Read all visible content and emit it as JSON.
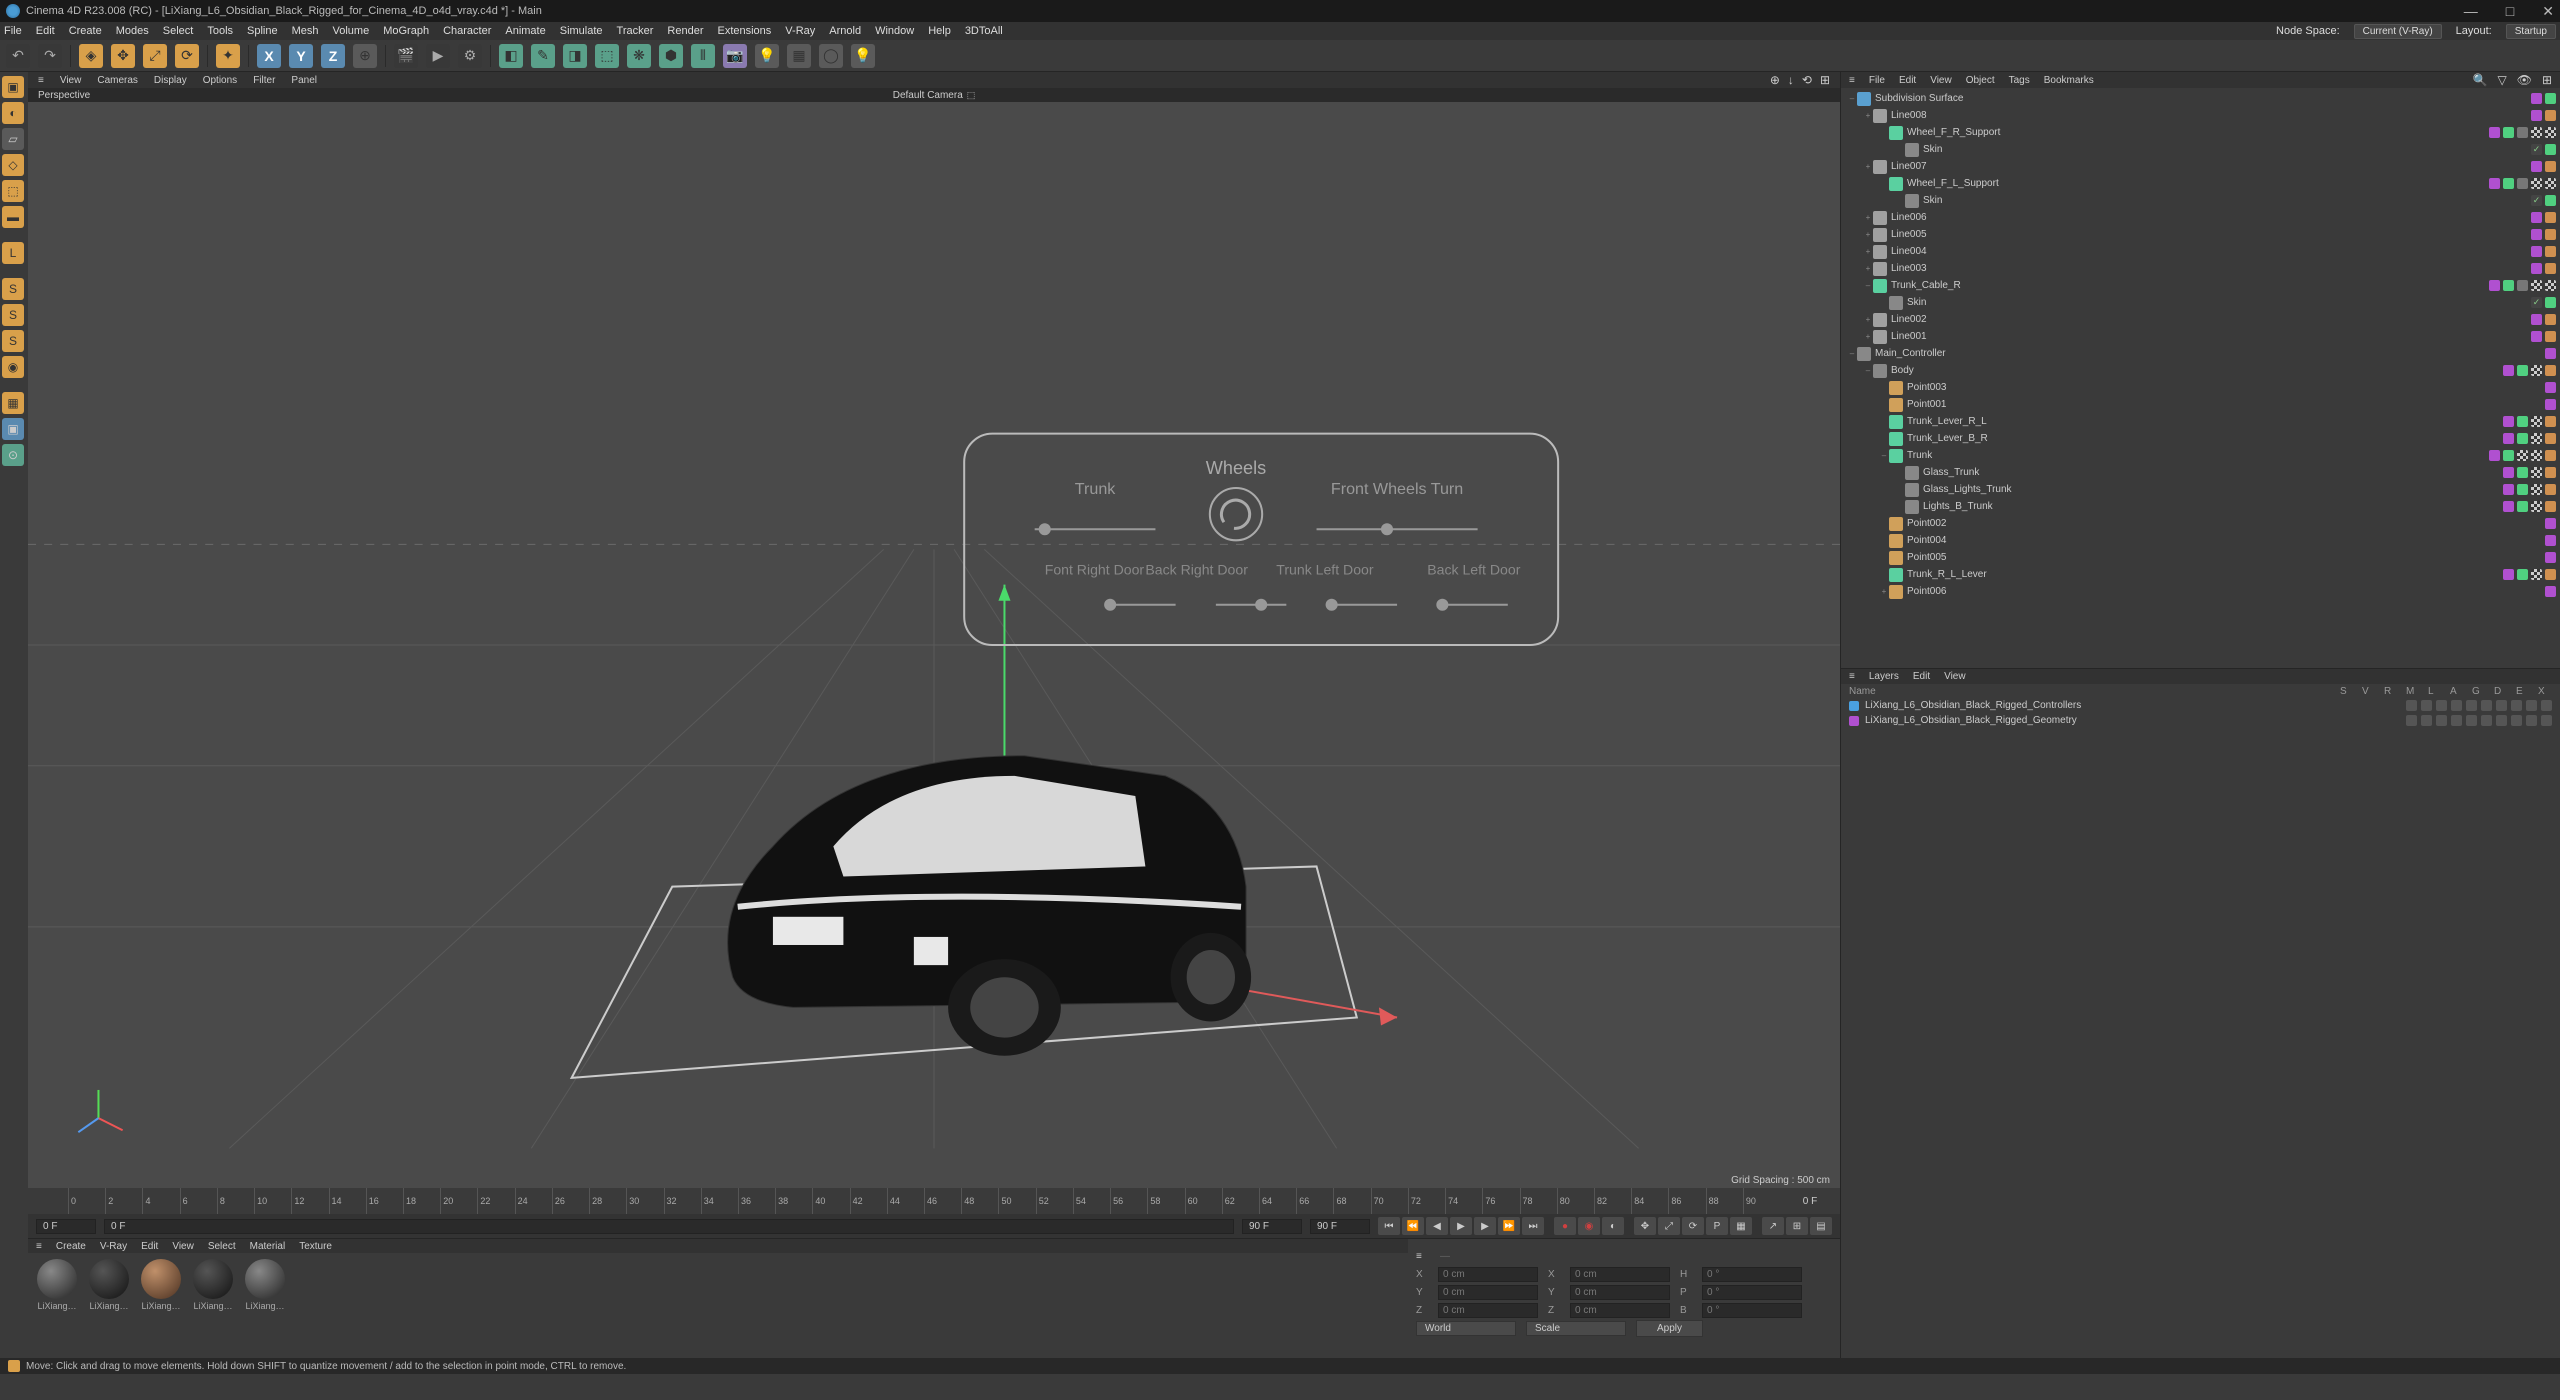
{
  "title": "Cinema 4D R23.008 (RC) - [LiXiang_L6_Obsidian_Black_Rigged_for_Cinema_4D_o4d_vray.c4d *] - Main",
  "menus": [
    "File",
    "Edit",
    "Create",
    "Modes",
    "Select",
    "Tools",
    "Spline",
    "Mesh",
    "Volume",
    "MoGraph",
    "Character",
    "Animate",
    "Simulate",
    "Tracker",
    "Render",
    "Extensions",
    "V-Ray",
    "Arnold",
    "Window",
    "Help",
    "3DToAll"
  ],
  "nodespace": {
    "label": "Node Space:",
    "value": "Current (V-Ray)"
  },
  "layout": {
    "label": "Layout:",
    "value": "Startup"
  },
  "viewport": {
    "menus": [
      "View",
      "Cameras",
      "Display",
      "Options",
      "Filter",
      "Panel"
    ],
    "tab": "Perspective",
    "camera": "Default Camera",
    "gridinfo": "Grid Spacing : 500 cm",
    "hud": {
      "wheels": "Wheels",
      "trunk": "Trunk",
      "frontwheels": "Front Wheels Turn",
      "frdoor": "Font Right Door",
      "brdoor": "Back Right Door",
      "tldoor": "Trunk Left Door",
      "bldoor": "Back Left Door"
    }
  },
  "obj_menus": [
    "File",
    "Edit",
    "View",
    "Object",
    "Tags",
    "Bookmarks"
  ],
  "tree": [
    {
      "d": 0,
      "exp": "–",
      "icon": "cube",
      "name": "Subdivision Surface",
      "tags": [
        "purple",
        "green"
      ]
    },
    {
      "d": 1,
      "exp": "+",
      "icon": "line",
      "name": "Line008",
      "tags": [
        "purple",
        "orange"
      ]
    },
    {
      "d": 2,
      "exp": "",
      "icon": "joint",
      "name": "Wheel_F_R_Support",
      "tags": [
        "purple",
        "green",
        "gray",
        "checker",
        "checker"
      ]
    },
    {
      "d": 3,
      "exp": "",
      "icon": "null",
      "name": "Skin",
      "tags": [
        "check",
        "green"
      ]
    },
    {
      "d": 1,
      "exp": "+",
      "icon": "line",
      "name": "Line007",
      "tags": [
        "purple",
        "orange"
      ]
    },
    {
      "d": 2,
      "exp": "",
      "icon": "joint",
      "name": "Wheel_F_L_Support",
      "tags": [
        "purple",
        "green",
        "gray",
        "checker",
        "checker"
      ]
    },
    {
      "d": 3,
      "exp": "",
      "icon": "null",
      "name": "Skin",
      "tags": [
        "check",
        "green"
      ]
    },
    {
      "d": 1,
      "exp": "+",
      "icon": "line",
      "name": "Line006",
      "tags": [
        "purple",
        "orange"
      ]
    },
    {
      "d": 1,
      "exp": "+",
      "icon": "line",
      "name": "Line005",
      "tags": [
        "purple",
        "orange"
      ]
    },
    {
      "d": 1,
      "exp": "+",
      "icon": "line",
      "name": "Line004",
      "tags": [
        "purple",
        "orange"
      ]
    },
    {
      "d": 1,
      "exp": "+",
      "icon": "line",
      "name": "Line003",
      "tags": [
        "purple",
        "orange"
      ]
    },
    {
      "d": 1,
      "exp": "–",
      "icon": "joint",
      "name": "Trunk_Cable_R",
      "tags": [
        "purple",
        "green",
        "gray",
        "checker",
        "checker"
      ]
    },
    {
      "d": 2,
      "exp": "",
      "icon": "null",
      "name": "Skin",
      "tags": [
        "check",
        "green"
      ]
    },
    {
      "d": 1,
      "exp": "+",
      "icon": "line",
      "name": "Line002",
      "tags": [
        "purple",
        "orange"
      ]
    },
    {
      "d": 1,
      "exp": "+",
      "icon": "line",
      "name": "Line001",
      "tags": [
        "purple",
        "orange"
      ]
    },
    {
      "d": 0,
      "exp": "–",
      "icon": "null",
      "name": "Main_Controller",
      "tags": [
        "purple"
      ]
    },
    {
      "d": 1,
      "exp": "–",
      "icon": "null",
      "name": "Body",
      "tags": [
        "purple",
        "green",
        "checker",
        "orange"
      ]
    },
    {
      "d": 2,
      "exp": "",
      "icon": "point",
      "name": "Point003",
      "tags": [
        "purple"
      ]
    },
    {
      "d": 2,
      "exp": "",
      "icon": "point",
      "name": "Point001",
      "tags": [
        "purple"
      ]
    },
    {
      "d": 2,
      "exp": "",
      "icon": "joint",
      "name": "Trunk_Lever_R_L",
      "tags": [
        "purple",
        "green",
        "checker",
        "orange"
      ]
    },
    {
      "d": 2,
      "exp": "",
      "icon": "joint",
      "name": "Trunk_Lever_B_R",
      "tags": [
        "purple",
        "green",
        "checker",
        "orange"
      ]
    },
    {
      "d": 2,
      "exp": "–",
      "icon": "joint",
      "name": "Trunk",
      "tags": [
        "purple",
        "green",
        "checker",
        "checker",
        "orange"
      ]
    },
    {
      "d": 3,
      "exp": "",
      "icon": "null",
      "name": "Glass_Trunk",
      "tags": [
        "purple",
        "green",
        "checker",
        "orange"
      ]
    },
    {
      "d": 3,
      "exp": "",
      "icon": "null",
      "name": "Glass_Lights_Trunk",
      "tags": [
        "purple",
        "green",
        "checker",
        "orange"
      ]
    },
    {
      "d": 3,
      "exp": "",
      "icon": "null",
      "name": "Lights_B_Trunk",
      "tags": [
        "purple",
        "green",
        "checker",
        "orange"
      ]
    },
    {
      "d": 2,
      "exp": "",
      "icon": "point",
      "name": "Point002",
      "tags": [
        "purple"
      ]
    },
    {
      "d": 2,
      "exp": "",
      "icon": "point",
      "name": "Point004",
      "tags": [
        "purple"
      ]
    },
    {
      "d": 2,
      "exp": "",
      "icon": "point",
      "name": "Point005",
      "tags": [
        "purple"
      ]
    },
    {
      "d": 2,
      "exp": "",
      "icon": "joint",
      "name": "Trunk_R_L_Lever",
      "tags": [
        "purple",
        "green",
        "checker",
        "orange"
      ]
    },
    {
      "d": 2,
      "exp": "+",
      "icon": "point",
      "name": "Point006",
      "tags": [
        "purple"
      ]
    }
  ],
  "layer_menus": [
    "Layers",
    "Edit",
    "View"
  ],
  "layer_cols": [
    "S",
    "V",
    "R",
    "M",
    "L",
    "A",
    "G",
    "D",
    "E",
    "X"
  ],
  "layers": [
    {
      "color": "#4aa0e0",
      "name": "LiXiang_L6_Obsidian_Black_Rigged_Controllers"
    },
    {
      "color": "#b050d0",
      "name": "LiXiang_L6_Obsidian_Black_Rigged_Geometry"
    }
  ],
  "timeline": {
    "start": "0 F",
    "startfield": "0 F",
    "end": "90 F",
    "endfield": "90 F",
    "range_end": "0 F"
  },
  "mat_menus": [
    "Create",
    "V-Ray",
    "Edit",
    "View",
    "Select",
    "Material",
    "Texture"
  ],
  "materials": [
    {
      "name": "LiXiang…",
      "cls": ""
    },
    {
      "name": "LiXiang…",
      "cls": "dark"
    },
    {
      "name": "LiXiang…",
      "cls": "brown"
    },
    {
      "name": "LiXiang…",
      "cls": "dark"
    },
    {
      "name": "LiXiang…",
      "cls": ""
    }
  ],
  "coords": {
    "X": "0 cm",
    "Y": "0 cm",
    "Z": "0 cm",
    "X2": "0 cm",
    "Y2": "0 cm",
    "Z2": "0 cm",
    "H": "0 °",
    "P": "0 °",
    "B": "0 °",
    "mode": "World",
    "scale": "Scale",
    "apply": "Apply"
  },
  "status": "Move: Click and drag to move elements. Hold down SHIFT to quantize movement / add to the selection in point mode, CTRL to remove."
}
